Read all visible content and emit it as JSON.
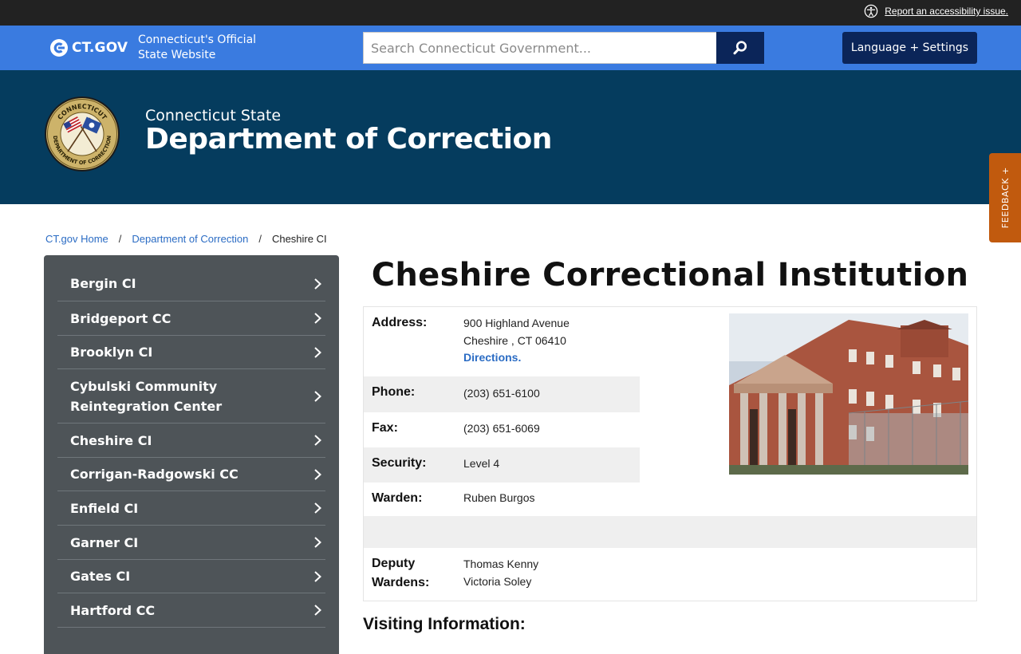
{
  "utility": {
    "accessibility_link": "Report an accessibility issue."
  },
  "ctbar": {
    "logo_text": "CT.GOV",
    "tagline": "Connecticut's Official State Website",
    "search_placeholder": "Search Connecticut Government...",
    "language_button": "Language + Settings"
  },
  "agency": {
    "subtitle": "Connecticut State",
    "title": "Department of Correction",
    "seal_text_top": "CONNECTICUT",
    "seal_text_bottom": "DEPARTMENT OF CORRECTION"
  },
  "feedback": {
    "label": "FEEDBACK +"
  },
  "breadcrumb": [
    {
      "label": "CT.gov Home"
    },
    {
      "label": "Department of Correction"
    },
    {
      "label": "Cheshire CI"
    }
  ],
  "sidebar": {
    "items": [
      {
        "label": "Bergin CI"
      },
      {
        "label": "Bridgeport CC"
      },
      {
        "label": "Brooklyn CI"
      },
      {
        "label": "Cybulski Community Reintegration Center"
      },
      {
        "label": "Cheshire CI"
      },
      {
        "label": "Corrigan-Radgowski CC"
      },
      {
        "label": "Enfield CI"
      },
      {
        "label": "Garner CI"
      },
      {
        "label": "Gates CI"
      },
      {
        "label": "Hartford CC"
      }
    ]
  },
  "main": {
    "title": "Cheshire Correctional Institution",
    "address_label": "Address:",
    "address_line1": "900 Highland Avenue",
    "address_line2": "Cheshire , CT 06410",
    "directions": "Directions.",
    "phone_label": "Phone:",
    "phone": "(203) 651-6100",
    "fax_label": "Fax:",
    "fax": "(203) 651-6069",
    "security_label": "Security:",
    "security": "Level 4",
    "warden_label": "Warden:",
    "warden": "Ruben Burgos",
    "deputy_label_1": "Deputy",
    "deputy_label_2": "Wardens:",
    "deputy_1": "Thomas Kenny",
    "deputy_2": "Victoria Soley",
    "visiting_heading": "Visiting Information:"
  },
  "colors": {
    "utility_bar": "#222222",
    "ct_blue": "#3a7be0",
    "navy": "#0b2559",
    "agency_banner": "#053c5e",
    "feedback": "#c15a0e",
    "sidebar": "#4e5458",
    "link": "#2b6cc4"
  }
}
